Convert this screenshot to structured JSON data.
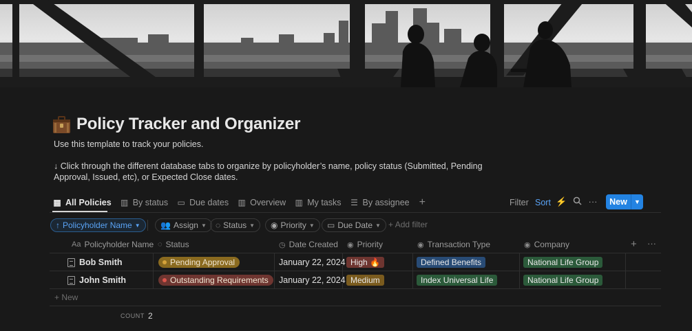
{
  "page": {
    "title": "Policy Tracker and Organizer",
    "icon": "briefcase-icon",
    "description_line1": "Use this template to track your policies.",
    "description_line2": "↓ Click through the different database tabs to organize by policyholder’s name, policy status (Submitted, Pending",
    "description_line3": "Approval, Issued, etc), or Expected Close dates."
  },
  "tabs": [
    {
      "label": "All Policies",
      "icon": "table-icon",
      "active": true
    },
    {
      "label": "By status",
      "icon": "board-icon"
    },
    {
      "label": "Due dates",
      "icon": "calendar-icon"
    },
    {
      "label": "Overview",
      "icon": "board-icon"
    },
    {
      "label": "My tasks",
      "icon": "board-icon"
    },
    {
      "label": "By assignee",
      "icon": "list-icon"
    }
  ],
  "toolbar": {
    "filter": "Filter",
    "sort": "Sort",
    "new_label": "New"
  },
  "filters": {
    "sort_chip": "Policyholder Name",
    "chips": [
      "Assign",
      "Status",
      "Priority",
      "Due Date"
    ],
    "add_filter": "Add filter"
  },
  "table": {
    "columns": [
      {
        "label": "Policyholder Name",
        "icon": "Aa"
      },
      {
        "label": "Status",
        "icon": "status-icon"
      },
      {
        "label": "Date Created",
        "icon": "clock-icon"
      },
      {
        "label": "Priority",
        "icon": "select-icon"
      },
      {
        "label": "Transaction Type",
        "icon": "select-icon"
      },
      {
        "label": "Company",
        "icon": "select-icon"
      }
    ],
    "rows": [
      {
        "name": "Bob Smith",
        "status": "Pending Approval",
        "status_color": "#8a6a1f",
        "status_dot": "#d4a23a",
        "date": "January 22, 2024",
        "priority": "High 🔥",
        "priority_color": "#6e3530",
        "transaction": "Defined Benefits",
        "transaction_color": "#284b75",
        "company": "National Life Group",
        "company_color": "#2b5a3a"
      },
      {
        "name": "John Smith",
        "status": "Outstanding Requirements",
        "status_color": "#6e3530",
        "status_dot": "#d9544b",
        "date": "January 22, 2024",
        "priority": "Medium",
        "priority_color": "#7a5b1e",
        "transaction": "Index Universal Life",
        "transaction_color": "#2b5a3a",
        "company": "National Life Group",
        "company_color": "#2b5a3a"
      }
    ],
    "new_row": "+ New",
    "count_label": "COUNT",
    "count_value": "2"
  }
}
